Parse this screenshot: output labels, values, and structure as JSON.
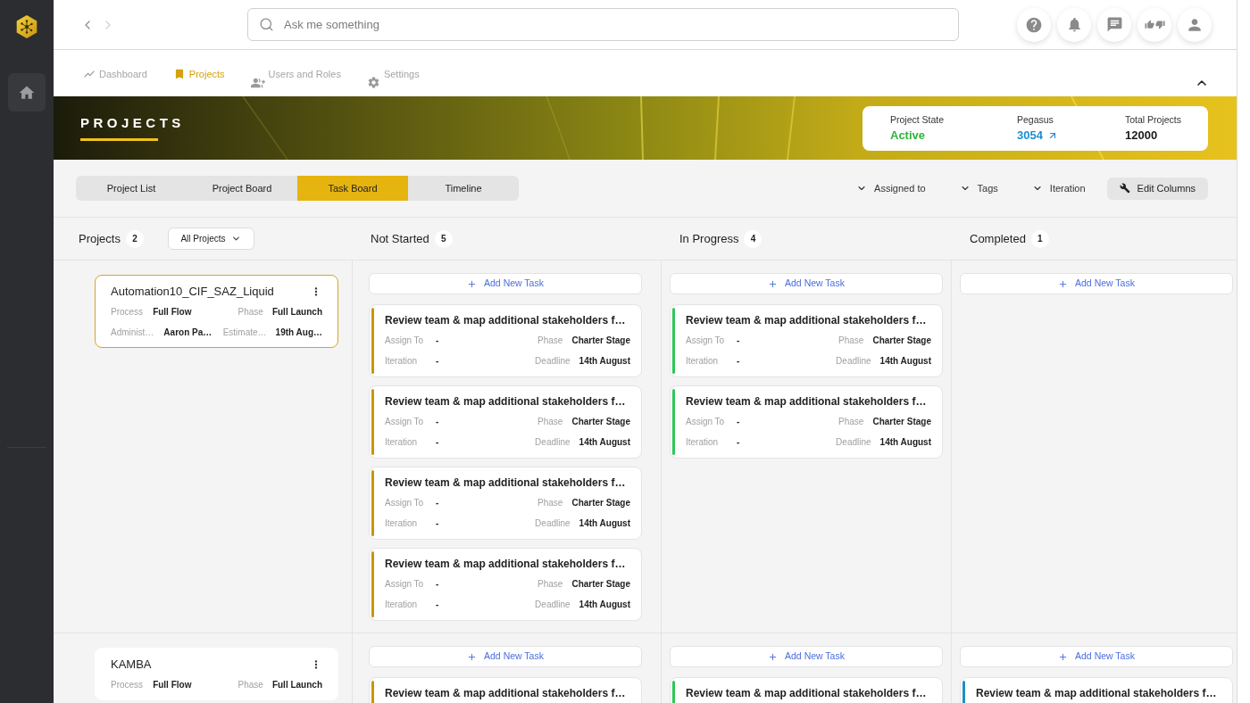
{
  "sidebar": {
    "items": [
      {
        "kind": "home",
        "selected": true
      }
    ]
  },
  "history": {
    "back": {
      "disabled": false
    },
    "forward": {
      "disabled": true
    }
  },
  "search": {
    "placeholder": "Ask me something"
  },
  "toolbar_icons": [
    {
      "kind": "help"
    },
    {
      "kind": "notifications"
    },
    {
      "kind": "messages"
    },
    {
      "kind": "feedback"
    },
    {
      "kind": "profile"
    }
  ],
  "nav": {
    "expanded": true,
    "items": [
      {
        "kind": "dashboard",
        "label": "Dashboard",
        "selected": false
      },
      {
        "kind": "projects",
        "label": "Projects",
        "selected": true
      },
      {
        "kind": "users",
        "label": "Users and Roles",
        "selected": false
      },
      {
        "kind": "settings",
        "label": "Settings",
        "selected": false
      }
    ]
  },
  "banner": {
    "title": "PROJECTS",
    "stats": [
      {
        "label": "Project State",
        "value": "Active",
        "kind": "status"
      },
      {
        "label": "Pegasus",
        "value": "3054",
        "kind": "link"
      },
      {
        "label": "Total Projects",
        "value": "12000",
        "kind": "plain"
      }
    ]
  },
  "view_tabs": [
    {
      "label": "Project List",
      "selected": false
    },
    {
      "label": "Project Board",
      "selected": false
    },
    {
      "label": "Task Board",
      "selected": true
    },
    {
      "label": "Timeline",
      "selected": false
    }
  ],
  "filters": [
    {
      "label": "Assigned to"
    },
    {
      "label": "Tags"
    },
    {
      "label": "Iteration"
    }
  ],
  "edit_columns": {
    "label": "Edit Columns"
  },
  "projects_header": {
    "title": "Projects",
    "count": "2",
    "dropdown": "All Projects"
  },
  "columns": [
    {
      "title": "Not Started",
      "count": "5",
      "color": "#c8960c"
    },
    {
      "title": "In Progress",
      "count": "4",
      "color": "#2fc65a"
    },
    {
      "title": "Completed",
      "count": "1",
      "color": "#1f8fc2"
    }
  ],
  "rows": [
    {
      "project": {
        "name": "Automation10_CIF_SAZ_Liquid",
        "selected": true,
        "fields": [
          {
            "label": "Process",
            "value": "Full Flow"
          },
          {
            "label": "Phase",
            "value": "Full Launch"
          },
          {
            "label": "Administ…",
            "value": "Aaron Pa…"
          },
          {
            "label": "Estimate…",
            "value": "19th Aug…"
          }
        ]
      },
      "lanes": [
        {
          "add_button": "Add New Task",
          "tasks": [
            {
              "title": "Review team & map additional stakeholders f…",
              "fields": [
                {
                  "label": "Assign To",
                  "value": "-"
                },
                {
                  "label": "Phase",
                  "value": "Charter Stage"
                },
                {
                  "label": "Iteration",
                  "value": "-"
                },
                {
                  "label": "Deadline",
                  "value": "14th August"
                }
              ]
            },
            {
              "title": "Review team & map additional stakeholders f…",
              "fields": [
                {
                  "label": "Assign To",
                  "value": "-"
                },
                {
                  "label": "Phase",
                  "value": "Charter Stage"
                },
                {
                  "label": "Iteration",
                  "value": "-"
                },
                {
                  "label": "Deadline",
                  "value": "14th August"
                }
              ]
            },
            {
              "title": "Review team & map additional stakeholders f…",
              "fields": [
                {
                  "label": "Assign To",
                  "value": "-"
                },
                {
                  "label": "Phase",
                  "value": "Charter Stage"
                },
                {
                  "label": "Iteration",
                  "value": "-"
                },
                {
                  "label": "Deadline",
                  "value": "14th August"
                }
              ]
            },
            {
              "title": "Review team & map additional stakeholders f…",
              "fields": [
                {
                  "label": "Assign To",
                  "value": "-"
                },
                {
                  "label": "Phase",
                  "value": "Charter Stage"
                },
                {
                  "label": "Iteration",
                  "value": "-"
                },
                {
                  "label": "Deadline",
                  "value": "14th August"
                }
              ]
            }
          ]
        },
        {
          "add_button": "Add New Task",
          "tasks": [
            {
              "title": "Review team & map additional stakeholders f…",
              "fields": [
                {
                  "label": "Assign To",
                  "value": "-"
                },
                {
                  "label": "Phase",
                  "value": "Charter Stage"
                },
                {
                  "label": "Iteration",
                  "value": "-"
                },
                {
                  "label": "Deadline",
                  "value": "14th August"
                }
              ]
            },
            {
              "title": "Review team & map additional stakeholders f…",
              "fields": [
                {
                  "label": "Assign To",
                  "value": "-"
                },
                {
                  "label": "Phase",
                  "value": "Charter Stage"
                },
                {
                  "label": "Iteration",
                  "value": "-"
                },
                {
                  "label": "Deadline",
                  "value": "14th August"
                }
              ]
            }
          ]
        },
        {
          "add_button": "Add New Task"
        }
      ]
    },
    {
      "project": {
        "name": "KAMBA",
        "selected": false,
        "fields": [
          {
            "label": "Process",
            "value": "Full Flow"
          },
          {
            "label": "Phase",
            "value": "Full Launch"
          }
        ]
      },
      "lanes": [
        {
          "add_button": "Add New Task",
          "tasks": [
            {
              "title": "Review team & map additional stakeholders f…"
            }
          ]
        },
        {
          "add_button": "Add New Task",
          "tasks": [
            {
              "title": "Review team & map additional stakeholders f…"
            }
          ]
        },
        {
          "add_button": "Add New Task",
          "tasks": [
            {
              "title": "Review team & map additional stakeholders f…"
            }
          ]
        }
      ]
    }
  ]
}
